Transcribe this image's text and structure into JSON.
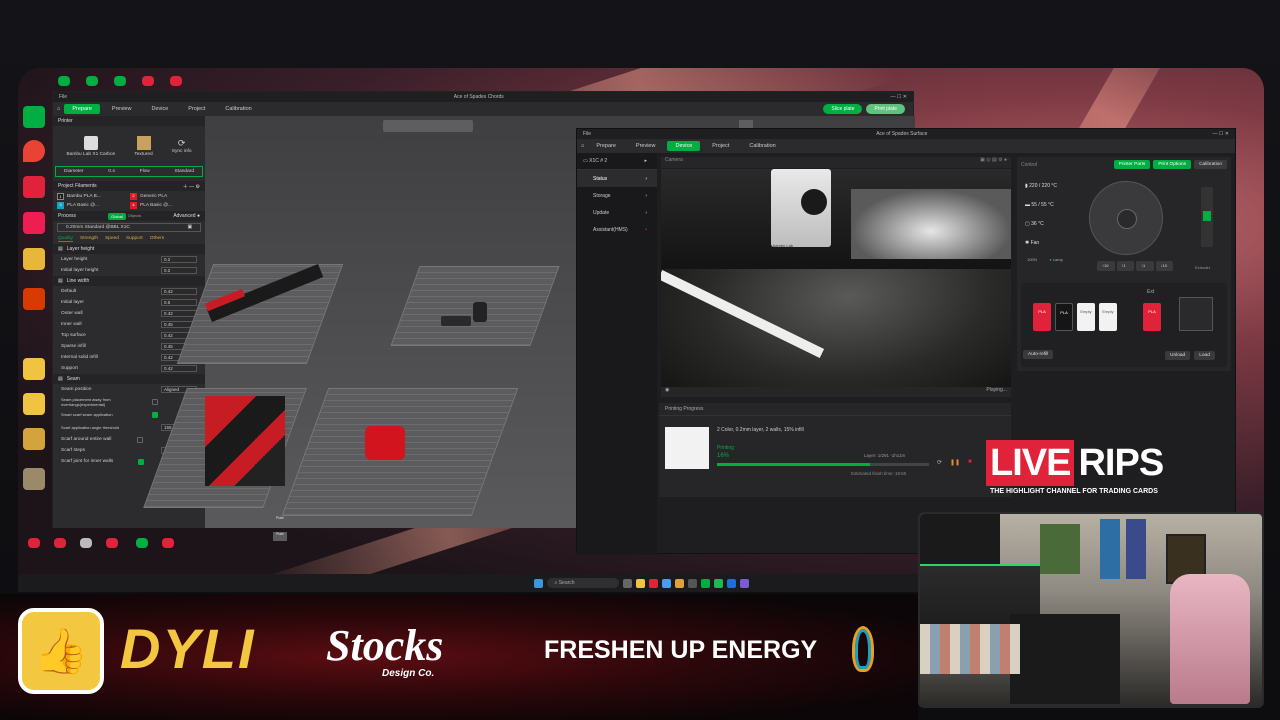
{
  "slicer": {
    "title": "Ace of Spades Chords",
    "file_menu": "File",
    "tabs": [
      {
        "label": "Prepare",
        "active": true
      },
      {
        "label": "Preview",
        "active": false
      },
      {
        "label": "Device",
        "active": false
      },
      {
        "label": "Project",
        "active": false
      },
      {
        "label": "Calibration",
        "active": false
      }
    ],
    "slice_button": "Slice plate",
    "print_button": "Print plate",
    "printer_section": "Printer",
    "printer_name": "Bambu Lab X1 Carbon",
    "plate_type": "Textured",
    "sync_info": "Sync info",
    "diameter_label": "Diameter",
    "diameter_value": "0.4",
    "flow_label": "Flow",
    "flow_value": "Standard",
    "filaments_section": "Project Filaments",
    "filaments": [
      {
        "num": "1",
        "name": "Bambu PLA B...",
        "color": "#1b1b1b"
      },
      {
        "num": "2",
        "name": "Generic PLA",
        "color": "#e01b24"
      },
      {
        "num": "3",
        "name": "PLA Basic @...",
        "color": "#1aa1c8"
      },
      {
        "num": "4",
        "name": "PLA Basic @...",
        "color": "#e01b24"
      }
    ],
    "process_label": "Process",
    "process_toggle_a": "Global",
    "process_toggle_b": "Objects",
    "advanced_label": "Advanced",
    "profile": "0.20mm Standard @BBL X1C",
    "quality_tabs": [
      "Quality",
      "Strength",
      "Speed",
      "Support",
      "Others"
    ],
    "layer_height_section": "Layer height",
    "layer_height_rows": [
      {
        "label": "Layer height",
        "value": "0.2",
        "unit": "mm"
      },
      {
        "label": "Initial layer height",
        "value": "0.2",
        "unit": "mm"
      }
    ],
    "line_width_section": "Line width",
    "line_width_rows": [
      {
        "label": "Default",
        "value": "0.42",
        "unit": "mm"
      },
      {
        "label": "Initial layer",
        "value": "0.5",
        "unit": "mm"
      },
      {
        "label": "Outer wall",
        "value": "0.42",
        "unit": "mm"
      },
      {
        "label": "Inner wall",
        "value": "0.45",
        "unit": "mm"
      },
      {
        "label": "Top surface",
        "value": "0.42",
        "unit": "mm"
      },
      {
        "label": "Sparse infill",
        "value": "0.45",
        "unit": "mm"
      },
      {
        "label": "Internal solid infill",
        "value": "0.42",
        "unit": "mm"
      },
      {
        "label": "Support",
        "value": "0.42",
        "unit": "mm"
      }
    ],
    "seam_section": "Seam",
    "seam_position_label": "Seam position",
    "seam_position_value": "Aligned",
    "seam_away_label": "Seam placement away from overhangs(experimental)",
    "smart_scarf_label": "Smart scarf seam application",
    "scarf_angle_label": "Scarf application angle threshold",
    "scarf_angle_value": "155",
    "scarf_wall_label": "Scarf around entire wall",
    "scarf_steps_label": "Scarf steps",
    "scarf_steps_value": "10",
    "scarf_inner_label": "Scarf joint for inner walls",
    "plate_labels": [
      "Plate",
      "Plate"
    ]
  },
  "device": {
    "title": "Ace of Spades Surface",
    "file_menu": "File",
    "tabs": [
      {
        "label": "Prepare",
        "active": false
      },
      {
        "label": "Preview",
        "active": false
      },
      {
        "label": "Device",
        "active": true
      },
      {
        "label": "Project",
        "active": false
      },
      {
        "label": "Calibration",
        "active": false
      }
    ],
    "printer": "X1C # 2",
    "sidebar": [
      {
        "label": "Status",
        "active": true
      },
      {
        "label": "Storage",
        "active": false
      },
      {
        "label": "Update",
        "active": false
      },
      {
        "label": "Assistant(HMS)",
        "active": false
      }
    ],
    "camera_label": "Camera",
    "camera_status": "Playing...",
    "camera_brand": "bambu Lab",
    "progress_section": "Printing Progress",
    "job_desc": "2 Color, 0.2mm layer, 2 walls, 15% infill",
    "job_state": "Printing",
    "job_percent": "16%",
    "progress_fraction": 0.72,
    "layer": "Layer: 1/291",
    "remaining": "-1h11m",
    "finish_time": "Estimated finish time: 19:50",
    "control_label": "Control",
    "printer_parts": "Printer Parts",
    "print_options": "Print Options",
    "calibration": "Calibration",
    "nozzle_temp": "220 / 220 °C",
    "bed_temp": "55 / 55 °C",
    "chamber_temp": "36 °C",
    "fan_label": "Fan",
    "speed_value": "100%",
    "lamp_label": "Lamp",
    "extruder_label": "Extruder",
    "spools": [
      {
        "text": "PLA",
        "color": "#e0233a"
      },
      {
        "text": "PLA",
        "color": "#151515"
      },
      {
        "text": "Empty",
        "color": "#f2f2f2"
      },
      {
        "text": "Empty",
        "color": "#f2f2f2"
      }
    ],
    "ext_label": "Ext",
    "ext_spool": "PLA",
    "auto_refill": "Auto-refill",
    "unload": "Unload",
    "load": "Load"
  },
  "desktop_icons": [
    "Bambu Studio",
    "Maps",
    "Chrome",
    "TikTok",
    "Camera",
    "Gallery",
    "Folder",
    "Folder",
    "Folder",
    "Folder"
  ],
  "taskbar": {
    "search_placeholder": "Search"
  },
  "overlay": {
    "live": "LIVE",
    "rips": "RIPS",
    "tagline": "THE HIGHLIGHT CHANNEL FOR TRADING CARDS",
    "sponsor_dyli": "DYLI",
    "sponsor_stocks": "Stocks",
    "sponsor_stocks_sub": "Design Co.",
    "sponsor_freshen": "FRESHEN UP ENERGY"
  }
}
